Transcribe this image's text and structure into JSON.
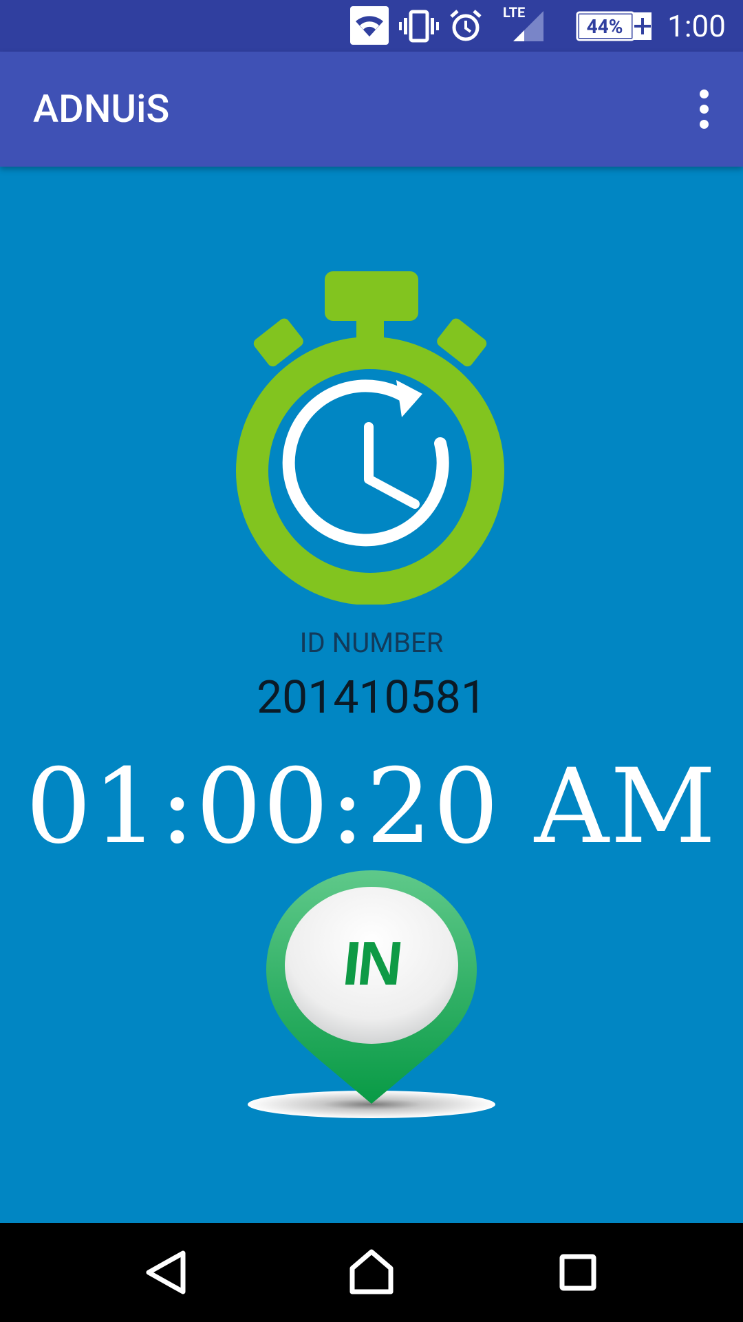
{
  "status_bar": {
    "time": "1:00",
    "battery_percent": "44%",
    "network": "LTE",
    "icons": [
      "wifi-icon",
      "vibrate-icon",
      "alarm-icon",
      "signal-icon",
      "battery-charging-icon"
    ]
  },
  "app_bar": {
    "title": "ADNUiS",
    "menu_icon": "more-vert-icon"
  },
  "main": {
    "id_label": "ID NUMBER",
    "id_value": "201410581",
    "time": "01:00:20 AM",
    "in_button_label": "IN"
  },
  "nav_bar": {
    "icons": [
      "back-icon",
      "home-icon",
      "recents-icon"
    ]
  },
  "colors": {
    "status_bar": "#303f9f",
    "app_bar": "#3f51b5",
    "background": "#0186c3",
    "stopwatch_green": "#82c41f",
    "pin_green": "#0ea04a"
  }
}
